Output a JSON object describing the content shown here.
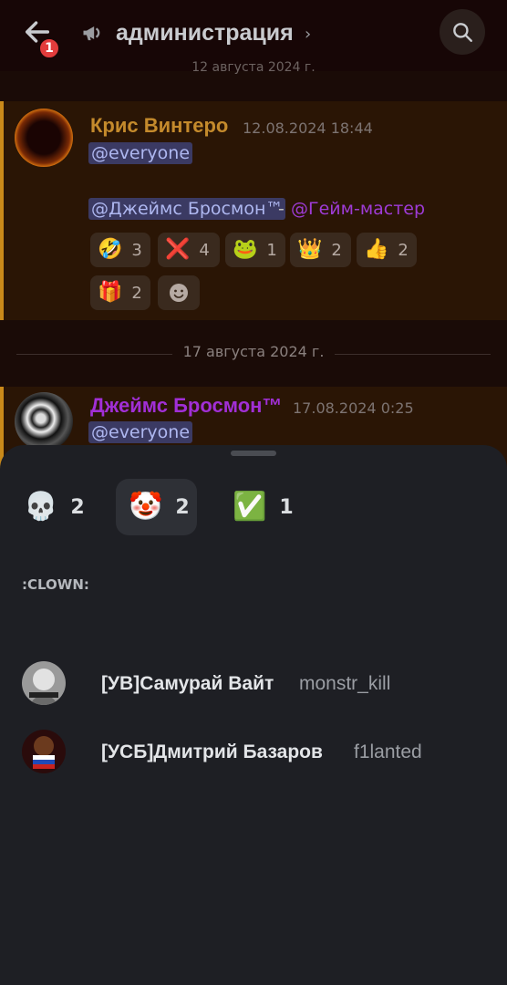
{
  "header": {
    "badge_count": "1",
    "channel_title": "администрация",
    "chevron": "›",
    "icons": {
      "back": "back-arrow-icon",
      "channel": "megaphone-icon",
      "search": "search-icon"
    }
  },
  "chat": {
    "date_top": "12 августа 2024 г.",
    "message1": {
      "author": "Крис Винтеро",
      "author_color": "#c48a2c",
      "timestamp": "12.08.2024 18:44",
      "mention_everyone": "@everyone",
      "mention_user": "@Джеймс Бросмон™",
      "dash": "-",
      "mention_role": "@Гейм-мастер",
      "reactions": [
        {
          "emoji": "🤣",
          "count": "3"
        },
        {
          "emoji": "❌",
          "count": "4"
        },
        {
          "emoji": "🐸",
          "count": "1"
        },
        {
          "emoji": "👑",
          "count": "2"
        },
        {
          "emoji": "👍",
          "count": "2"
        },
        {
          "emoji": "🎁",
          "count": "2"
        }
      ],
      "add_reaction_icon": "add-reaction-icon"
    },
    "date_divider": "17 августа 2024 г.",
    "message2": {
      "author": "Джеймс Бросмон™",
      "author_color": "#a12fd6",
      "timestamp": "17.08.2024 0:25",
      "mention_everyone": "@everyone"
    }
  },
  "sheet": {
    "tabs": [
      {
        "emoji": "💀",
        "count": "2"
      },
      {
        "emoji": "🤡",
        "count": "2"
      },
      {
        "emoji": "✅",
        "count": "1"
      }
    ],
    "section_label": ":CLOWN:",
    "users": [
      {
        "name": "[УВ]Самурай Вайт",
        "handle": "monstr_kill"
      },
      {
        "name": "[УСБ]Дмитрий Базаров",
        "handle": "f1lanted"
      }
    ]
  },
  "colors": {
    "sheet_bg": "#1e1f24",
    "active_tab": "#2e3036",
    "mention_bg": "#3b3a63",
    "role": "#9e3bd6",
    "badge": "#e23c3c"
  }
}
